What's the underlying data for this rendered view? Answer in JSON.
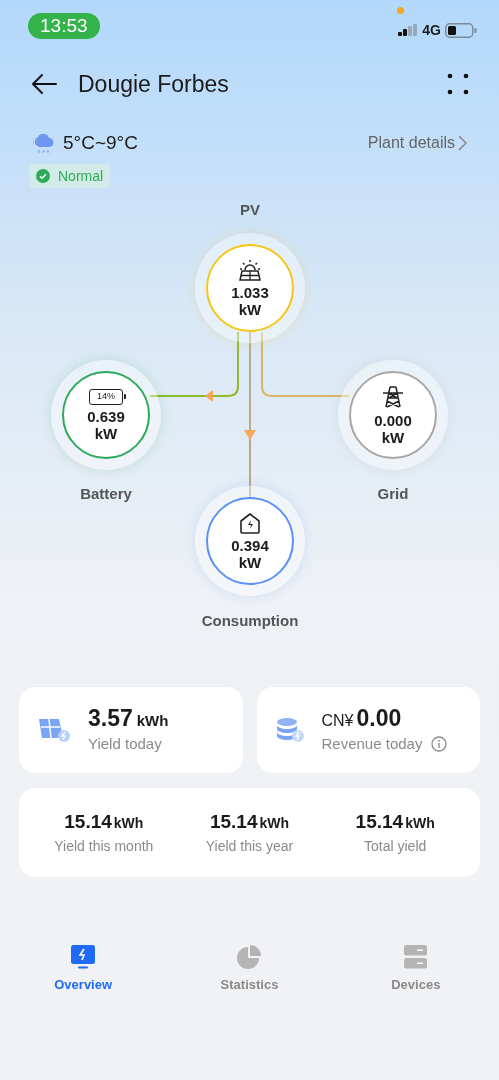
{
  "status_bar": {
    "time": "13:53",
    "network": "4G"
  },
  "header": {
    "title": "Dougie Forbes"
  },
  "weather": {
    "temperature": "5°C~9°C"
  },
  "plant_details_link": "Plant details",
  "status_badge": {
    "label": "Normal"
  },
  "flow": {
    "nodes": [
      {
        "kind": "pv",
        "label": "PV",
        "value": "1.033",
        "unit": "kW",
        "color": "#f5c518"
      },
      {
        "kind": "battery",
        "label": "Battery",
        "value": "0.639",
        "unit": "kW",
        "color": "#2eaa5c",
        "battery_text": "14%"
      },
      {
        "kind": "grid",
        "label": "Grid",
        "value": "0.000",
        "unit": "kW",
        "color": "#a8a8a8"
      },
      {
        "kind": "consumption",
        "label": "Consumption",
        "value": "0.394",
        "unit": "kW",
        "color": "#5b8ff9"
      }
    ]
  },
  "today": [
    {
      "kind": "yield",
      "value": "3.57",
      "unit": "kWh",
      "label": "Yield today"
    },
    {
      "kind": "revenue",
      "currency": "CN¥",
      "value": "0.00",
      "label": "Revenue today"
    }
  ],
  "totals": [
    {
      "value": "15.14",
      "unit": "kWh",
      "label": "Yield this month"
    },
    {
      "value": "15.14",
      "unit": "kWh",
      "label": "Yield this year"
    },
    {
      "value": "15.14",
      "unit": "kWh",
      "label": "Total yield"
    }
  ],
  "tabs": [
    {
      "kind": "overview",
      "label": "Overview",
      "selected": true
    },
    {
      "kind": "statistics",
      "label": "Statistics",
      "selected": false
    },
    {
      "kind": "devices",
      "label": "Devices",
      "selected": false
    }
  ]
}
